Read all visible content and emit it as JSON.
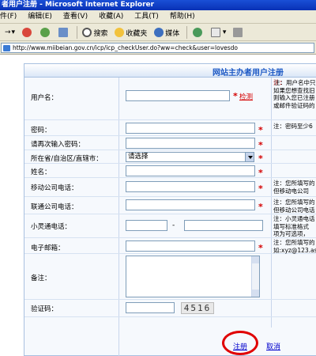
{
  "window": {
    "title": "者用户注册 - Microsoft Internet Explorer"
  },
  "menu": [
    "件(F)",
    "编辑(E)",
    "查看(V)",
    "收藏(A)",
    "工具(T)",
    "帮助(H)"
  ],
  "toolbar": {
    "search": "搜索",
    "favorites": "收藏夹",
    "media": "媒体"
  },
  "address": {
    "url": "http://www.miibeian.gov.cn/icp/icp_checkUser.do?ww=check&user=lovesdo"
  },
  "form": {
    "title": "网站主办者用户注册",
    "username": {
      "label": "用户名：",
      "value": "",
      "star": "*",
      "link": "检测",
      "note": [
        "注：用户名中只",
        "如果您想查找旧",
        "则输入您已注册",
        "或邮件验证码的"
      ]
    },
    "password": {
      "label": "密码：",
      "value": "",
      "star": "*",
      "note": "注：密码至少6"
    },
    "confirm_password": {
      "label": "请再次输入密码：",
      "value": "",
      "star": "*"
    },
    "province": {
      "label": "所在省/自治区/直辖市：",
      "selected": "请选择",
      "star": "*"
    },
    "name": {
      "label": "姓名：",
      "value": "",
      "star": "*"
    },
    "mobile": {
      "label": "移动公司电话：",
      "value": "",
      "star": "*",
      "note": [
        "注：您所填写的",
        "但移动电公司"
      ]
    },
    "unicom": {
      "label": "联通公司电话：",
      "value": "",
      "star": "*",
      "note": [
        "注：您所填写的",
        "但移动公司电话"
      ]
    },
    "phs": {
      "label": "小灵通电话：",
      "dash": "-",
      "value1": "",
      "value2": "",
      "note": [
        "注：小灵通电话",
        "填写标准格式",
        "项为可选项，"
      ]
    },
    "email": {
      "label": "电子邮箱：",
      "value": "",
      "star": "*",
      "note": [
        "注：您所填写的",
        "如:xyz@123.as"
      ]
    },
    "remark": {
      "label": "备注：",
      "value": ""
    },
    "captcha": {
      "label": "验证码：",
      "value": "",
      "code": "4516"
    },
    "register": "注册",
    "cancel": "取消"
  },
  "colors": {
    "star": "#d40000",
    "title": "#1a57c4",
    "link": "#0000cc",
    "circle": "#e00000"
  }
}
